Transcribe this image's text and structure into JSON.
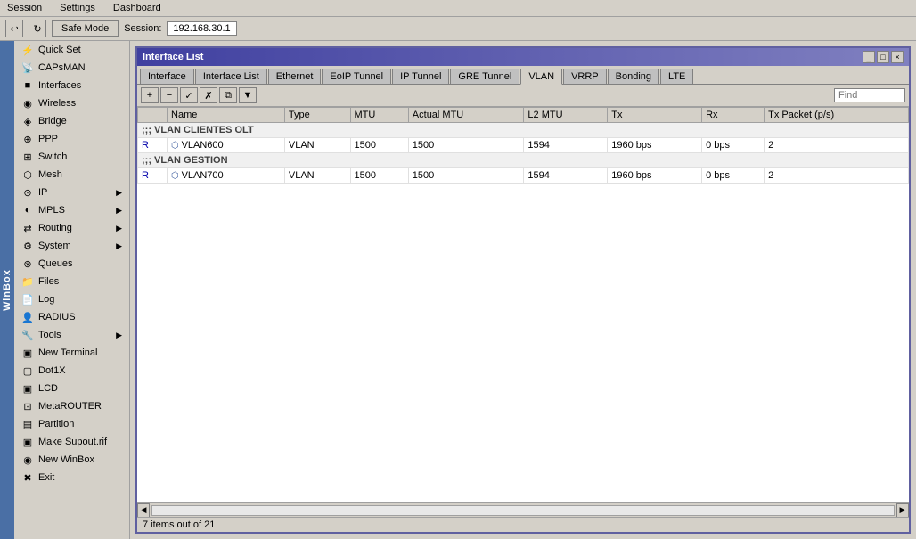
{
  "menu": {
    "items": [
      "Session",
      "Settings",
      "Dashboard"
    ]
  },
  "toolbar": {
    "undo_label": "↩",
    "redo_label": "↻",
    "safe_mode_label": "Safe Mode",
    "session_label": "Session:",
    "session_value": "192.168.30.1"
  },
  "sidebar": {
    "items": [
      {
        "id": "quick-set",
        "label": "Quick Set",
        "icon": "⚡",
        "has_sub": false
      },
      {
        "id": "capsman",
        "label": "CAPsMAN",
        "icon": "📡",
        "has_sub": false
      },
      {
        "id": "interfaces",
        "label": "Interfaces",
        "icon": "■",
        "has_sub": false
      },
      {
        "id": "wireless",
        "label": "Wireless",
        "icon": "◉",
        "has_sub": false
      },
      {
        "id": "bridge",
        "label": "Bridge",
        "icon": "◈",
        "has_sub": false
      },
      {
        "id": "ppp",
        "label": "PPP",
        "icon": "⊕",
        "has_sub": false
      },
      {
        "id": "switch",
        "label": "Switch",
        "icon": "⊞",
        "has_sub": false
      },
      {
        "id": "mesh",
        "label": "Mesh",
        "icon": "⬡",
        "has_sub": false
      },
      {
        "id": "ip",
        "label": "IP",
        "icon": "⊙",
        "has_sub": true
      },
      {
        "id": "mpls",
        "label": "MPLS",
        "icon": "◐",
        "has_sub": true
      },
      {
        "id": "routing",
        "label": "Routing",
        "icon": "⇄",
        "has_sub": true
      },
      {
        "id": "system",
        "label": "System",
        "icon": "⚙",
        "has_sub": true
      },
      {
        "id": "queues",
        "label": "Queues",
        "icon": "⊛",
        "has_sub": false
      },
      {
        "id": "files",
        "label": "Files",
        "icon": "📁",
        "has_sub": false
      },
      {
        "id": "log",
        "label": "Log",
        "icon": "📄",
        "has_sub": false
      },
      {
        "id": "radius",
        "label": "RADIUS",
        "icon": "👤",
        "has_sub": false
      },
      {
        "id": "tools",
        "label": "Tools",
        "icon": "🔧",
        "has_sub": true
      },
      {
        "id": "new-terminal",
        "label": "New Terminal",
        "icon": "▣",
        "has_sub": false
      },
      {
        "id": "dot1x",
        "label": "Dot1X",
        "icon": "▢",
        "has_sub": false
      },
      {
        "id": "lcd",
        "label": "LCD",
        "icon": "▣",
        "has_sub": false
      },
      {
        "id": "metarouter",
        "label": "MetaROUTER",
        "icon": "⊡",
        "has_sub": false
      },
      {
        "id": "partition",
        "label": "Partition",
        "icon": "▤",
        "has_sub": false
      },
      {
        "id": "make-supout",
        "label": "Make Supout.rif",
        "icon": "▣",
        "has_sub": false
      },
      {
        "id": "new-winbox",
        "label": "New WinBox",
        "icon": "◉",
        "has_sub": false
      },
      {
        "id": "exit",
        "label": "Exit",
        "icon": "✖",
        "has_sub": false
      }
    ],
    "winbox_label": "WinBox"
  },
  "window": {
    "title": "Interface List",
    "tabs": [
      {
        "id": "interface",
        "label": "Interface"
      },
      {
        "id": "interface-list",
        "label": "Interface List"
      },
      {
        "id": "ethernet",
        "label": "Ethernet"
      },
      {
        "id": "eoip-tunnel",
        "label": "EoIP Tunnel"
      },
      {
        "id": "ip-tunnel",
        "label": "IP Tunnel"
      },
      {
        "id": "gre-tunnel",
        "label": "GRE Tunnel"
      },
      {
        "id": "vlan",
        "label": "VLAN"
      },
      {
        "id": "vrrp",
        "label": "VRRP"
      },
      {
        "id": "bonding",
        "label": "Bonding"
      },
      {
        "id": "lte",
        "label": "LTE"
      }
    ],
    "active_tab": "vlan",
    "toolbar_buttons": [
      {
        "id": "add",
        "icon": "+",
        "title": "Add"
      },
      {
        "id": "remove",
        "icon": "−",
        "title": "Remove"
      },
      {
        "id": "enable",
        "icon": "✓",
        "title": "Enable"
      },
      {
        "id": "disable",
        "icon": "✗",
        "title": "Disable"
      },
      {
        "id": "copy",
        "icon": "⧉",
        "title": "Copy"
      },
      {
        "id": "filter",
        "icon": "▼",
        "title": "Filter"
      }
    ],
    "search_placeholder": "Find",
    "columns": [
      {
        "id": "flag",
        "label": ""
      },
      {
        "id": "name",
        "label": "Name"
      },
      {
        "id": "type",
        "label": "Type"
      },
      {
        "id": "mtu",
        "label": "MTU"
      },
      {
        "id": "actual-mtu",
        "label": "Actual MTU"
      },
      {
        "id": "l2-mtu",
        "label": "L2 MTU"
      },
      {
        "id": "tx",
        "label": "Tx"
      },
      {
        "id": "rx",
        "label": "Rx"
      },
      {
        "id": "tx-packet",
        "label": "Tx Packet (p/s)"
      }
    ],
    "sections": [
      {
        "id": "vlan-clientes-olt",
        "header": ";;; VLAN CLIENTES OLT",
        "rows": [
          {
            "flag": "R",
            "name": "VLAN600",
            "type": "VLAN",
            "mtu": "1500",
            "actual_mtu": "1500",
            "l2_mtu": "1594",
            "tx": "1960 bps",
            "rx": "0 bps",
            "tx_packet": "2"
          }
        ]
      },
      {
        "id": "vlan-gestion",
        "header": ";;; VLAN GESTION",
        "rows": [
          {
            "flag": "R",
            "name": "VLAN700",
            "type": "VLAN",
            "mtu": "1500",
            "actual_mtu": "1500",
            "l2_mtu": "1594",
            "tx": "1960 bps",
            "rx": "0 bps",
            "tx_packet": "2"
          }
        ]
      }
    ],
    "status": "7 items out of 21"
  }
}
